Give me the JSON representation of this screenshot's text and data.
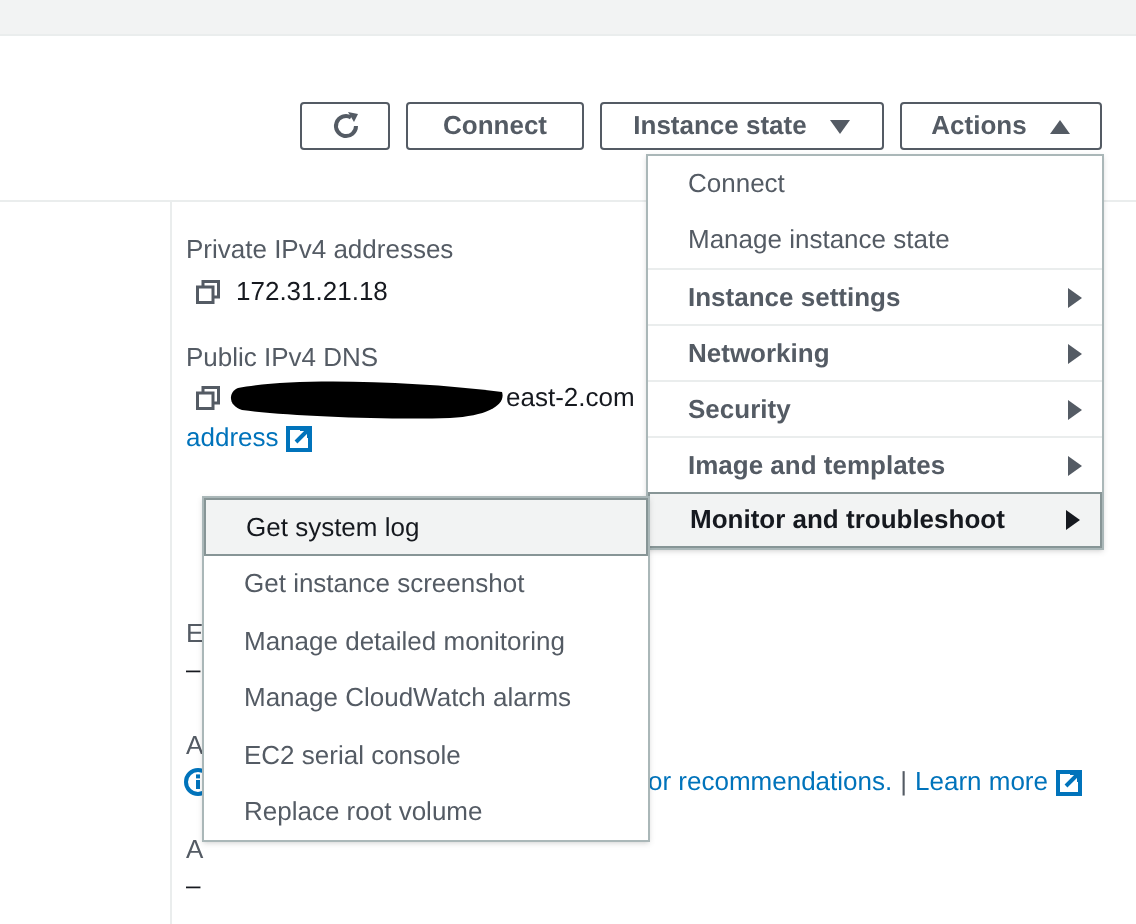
{
  "toolbar": {
    "buttons": [
      {
        "kind": "refresh"
      },
      {
        "kind": "text",
        "label": "Connect"
      },
      {
        "kind": "dropdown",
        "label": "Instance state",
        "expanded": false
      },
      {
        "kind": "dropdown",
        "label": "Actions",
        "expanded": true
      }
    ]
  },
  "details": {
    "private_ipv4": {
      "label": "Private IPv4 addresses",
      "value": "172.31.21.18"
    },
    "public_dns": {
      "label": "Public IPv4 DNS",
      "value": "east-2.com",
      "link": "address"
    },
    "rows": [
      {
        "kind": "value",
        "label": "E",
        "value": "–"
      },
      {
        "kind": "info",
        "label": "A",
        "text": "or recommendations.",
        "separator": "|",
        "link": "Learn more"
      },
      {
        "kind": "value",
        "label": "A",
        "value": "–"
      }
    ]
  },
  "actions_menu": {
    "items": [
      {
        "label": "Connect",
        "has_submenu": false,
        "selected": false
      },
      {
        "label": "Manage instance state",
        "has_submenu": false,
        "selected": false
      },
      {
        "label": "Instance settings",
        "has_submenu": true,
        "selected": false
      },
      {
        "label": "Networking",
        "has_submenu": true,
        "selected": false
      },
      {
        "label": "Security",
        "has_submenu": true,
        "selected": false
      },
      {
        "label": "Image and templates",
        "has_submenu": true,
        "selected": false
      },
      {
        "label": "Monitor and troubleshoot",
        "has_submenu": true,
        "selected": true
      }
    ]
  },
  "submenu": {
    "items": [
      {
        "label": "Get system log",
        "selected": true
      },
      {
        "label": "Get instance screenshot",
        "selected": false
      },
      {
        "label": "Manage detailed monitoring",
        "selected": false
      },
      {
        "label": "Manage CloudWatch alarms",
        "selected": false
      },
      {
        "label": "EC2 serial console",
        "selected": false
      },
      {
        "label": "Replace root volume",
        "selected": false
      }
    ]
  }
}
